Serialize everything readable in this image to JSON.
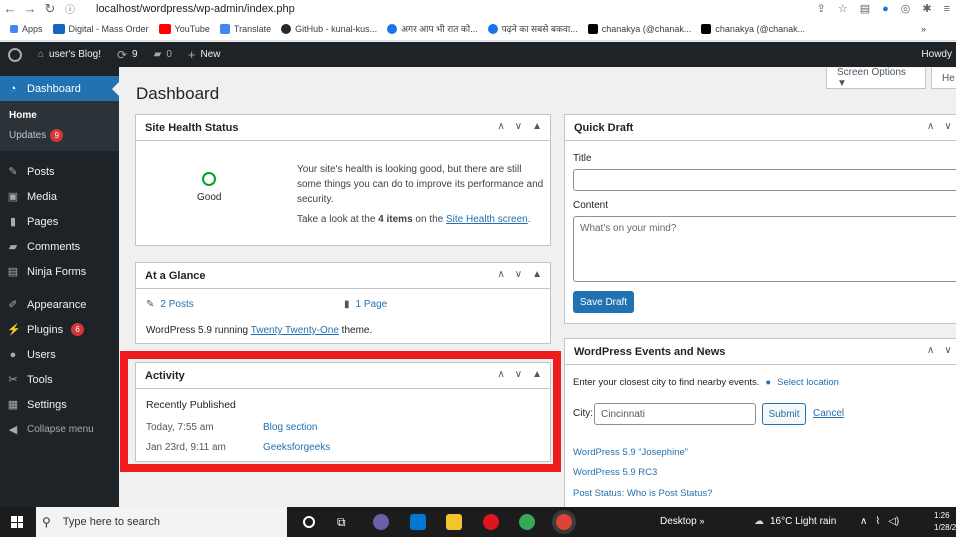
{
  "browser": {
    "url": "localhost/wordpress/wp-admin/index.php",
    "bookmarks": [
      "Apps",
      "Digital - Mass Order",
      "YouTube",
      "Translate",
      "GitHub - kunal-kus...",
      "अगर आप भी रात को...",
      "पढ़ने का सबसे बकवा...",
      "chanakya (@chanak...",
      "chanakya (@chanak..."
    ],
    "more": "»"
  },
  "adminbar": {
    "site": "user's Blog!",
    "updates": "9",
    "comments": "0",
    "new": "New",
    "howdy": "Howdy"
  },
  "sidebar": {
    "dashboard": "Dashboard",
    "home": "Home",
    "updates": "Updates",
    "updates_badge": "9",
    "posts": "Posts",
    "media": "Media",
    "pages": "Pages",
    "comments": "Comments",
    "ninja": "Ninja Forms",
    "appearance": "Appearance",
    "plugins": "Plugins",
    "plugins_badge": "6",
    "users": "Users",
    "tools": "Tools",
    "settings": "Settings",
    "collapse": "Collapse menu"
  },
  "page": {
    "title": "Dashboard",
    "screen_options": "Screen Options ▼",
    "help": "He"
  },
  "site_health": {
    "title": "Site Health Status",
    "status": "Good",
    "text1": "Your site's health is looking good, but there are still some things you can do to improve its performance and security.",
    "text2_pre": "Take a look at the ",
    "text2_bold": "4 items",
    "text2_mid": " on the ",
    "text2_link": "Site Health screen",
    "text2_post": "."
  },
  "glance": {
    "title": "At a Glance",
    "posts": "2 Posts",
    "pages": "1 Page",
    "version_pre": "WordPress 5.9 running ",
    "theme": "Twenty Twenty-One",
    "version_post": " theme."
  },
  "activity": {
    "title": "Activity",
    "subtitle": "Recently Published",
    "rows": [
      {
        "date": "Today, 7:55 am",
        "post": "Blog section"
      },
      {
        "date": "Jan 23rd, 9:11 am",
        "post": "Geeksforgeeks"
      }
    ]
  },
  "quick_draft": {
    "title": "Quick Draft",
    "title_label": "Title",
    "content_label": "Content",
    "content_placeholder": "What's on your mind?",
    "save": "Save Draft"
  },
  "events": {
    "title": "WordPress Events and News",
    "prompt": "Enter your closest city to find nearby events.",
    "select_location": "Select location",
    "city_label": "City:",
    "city_value": "Cincinnati",
    "submit": "Submit",
    "cancel": "Cancel",
    "news": [
      "WordPress 5.9 “Josephine”",
      "WordPress 5.9 RC3",
      "Post Status: Who is Post Status?"
    ]
  },
  "taskbar": {
    "search_placeholder": "Type here to search",
    "desktop": "Desktop",
    "weather": "16°C  Light rain",
    "time": "1:26",
    "date": "1/28/2"
  },
  "colors": {
    "wp_blue": "#2271b1",
    "admin_dark": "#1d2327",
    "highlight_red": "#ee1c1c",
    "badge_red": "#d63638"
  }
}
